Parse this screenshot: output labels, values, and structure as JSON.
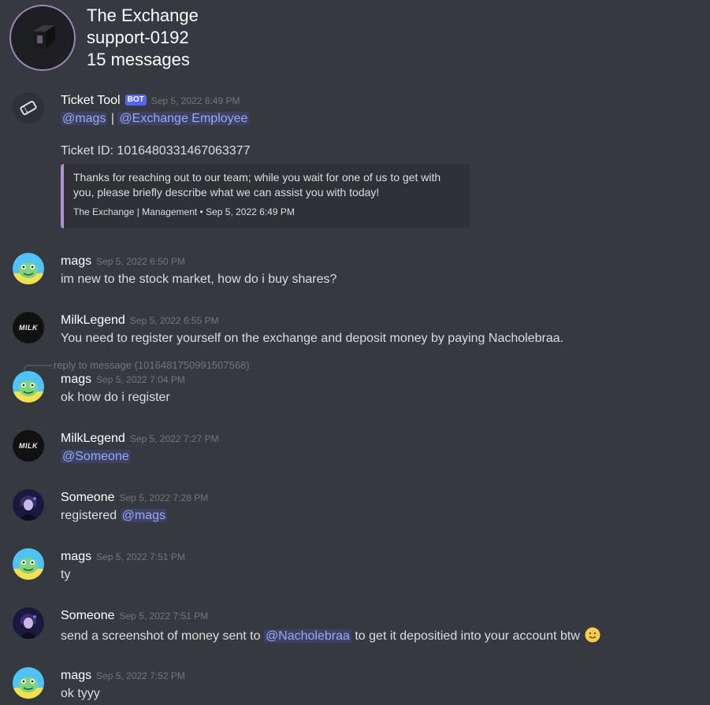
{
  "header": {
    "guild_name": "The Exchange",
    "channel_name": "support-0192",
    "message_count": "15 messages"
  },
  "messages": [
    {
      "author": "Ticket Tool",
      "bot_tag": "BOT",
      "timestamp": "Sep 5, 2022 6:49 PM",
      "mention_1": "@mags",
      "separator": "|",
      "mention_2": "@Exchange Employee",
      "ticket_line": "Ticket ID: 1016480331467063377",
      "embed": {
        "description": "Thanks for reaching out to our team; while you wait for one of us to get with you, please briefly describe what we can assist you with today!",
        "footer": "The Exchange | Management • Sep 5, 2022 6:49 PM",
        "accent": "#b28fd3"
      }
    },
    {
      "author": "mags",
      "timestamp": "Sep 5, 2022 6:50 PM",
      "text": "im new to the stock market, how do i buy shares?"
    },
    {
      "author": "MilkLegend",
      "timestamp": "Sep 5, 2022 6:55 PM",
      "text": "You need to register yourself on the exchange and deposit money by paying Nacholebraa."
    },
    {
      "reply_to": "reply to message (1016481750991507568)",
      "author": "mags",
      "timestamp": "Sep 5, 2022 7:04 PM",
      "text": "ok how do i register"
    },
    {
      "author": "MilkLegend",
      "timestamp": "Sep 5, 2022 7:27 PM",
      "mention": "@Someone"
    },
    {
      "author": "Someone",
      "timestamp": "Sep 5, 2022 7:28 PM",
      "text": "registered",
      "mention": "@mags"
    },
    {
      "author": "mags",
      "timestamp": "Sep 5, 2022 7:51 PM",
      "text": "ty"
    },
    {
      "author": "Someone",
      "timestamp": "Sep 5, 2022 7:51 PM",
      "text_before": "send a screenshot of money sent to",
      "mention": "@Nacholebraa",
      "text_after": "to get it depositied into your account btw",
      "emoji": "slightly-smiling-face-icon"
    },
    {
      "author": "mags",
      "timestamp": "Sep 5, 2022 7:52 PM",
      "text": "ok tyyy"
    }
  ],
  "avatar_text": {
    "milk": "MILK"
  },
  "colors": {
    "background": "#36393f",
    "mention": "#9ba8f6",
    "bot_tag": "#5865f2",
    "timestamp": "#72767d"
  }
}
